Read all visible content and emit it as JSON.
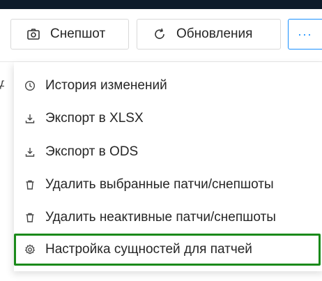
{
  "toolbar": {
    "snapshot_label": "Снепшот",
    "updates_label": "Обновления",
    "more_label": "···",
    "partial_text": "д"
  },
  "menu": {
    "items": [
      {
        "label": "История изменений",
        "icon": "clock-icon"
      },
      {
        "label": "Экспорт в XLSX",
        "icon": "download-icon"
      },
      {
        "label": "Экспорт в ODS",
        "icon": "download-icon"
      },
      {
        "label": "Удалить выбранные патчи/снепшоты",
        "icon": "trash-icon"
      },
      {
        "label": "Удалить неактивные патчи/снепшоты",
        "icon": "trash-icon"
      },
      {
        "label": "Настройка сущностей для патчей",
        "icon": "gear-icon"
      }
    ]
  },
  "colors": {
    "topbar": "#0d1b2a",
    "accent": "#1890ff",
    "highlight_border": "#1a8a1a",
    "text": "#262626"
  }
}
